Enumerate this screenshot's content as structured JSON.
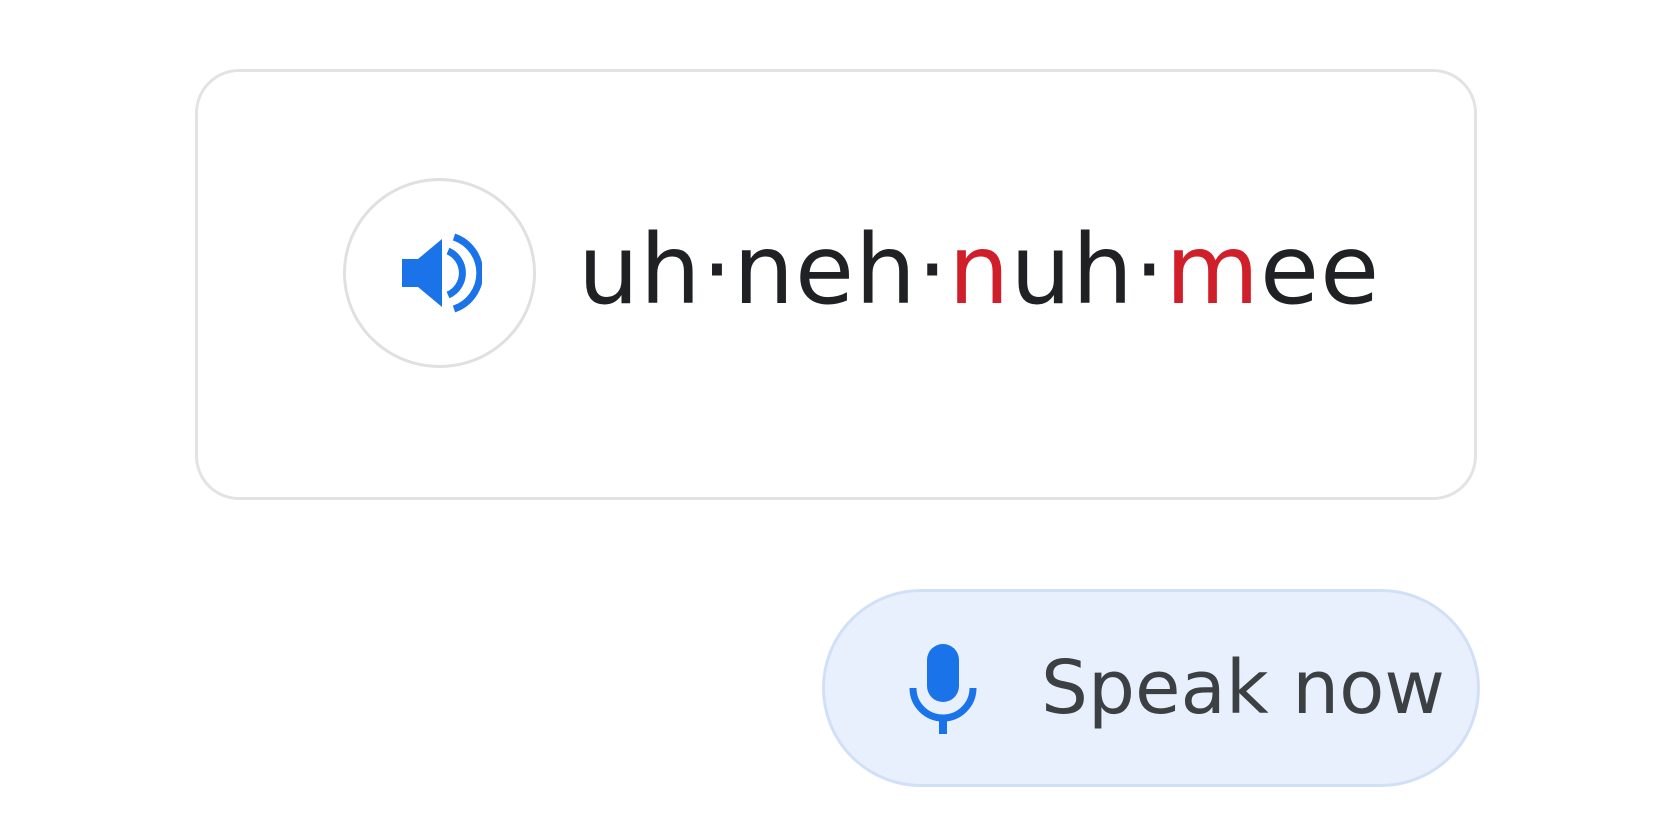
{
  "pronunciation": {
    "syllables": [
      {
        "text": "uh",
        "stressed": false
      },
      {
        "text": "·",
        "stressed": false
      },
      {
        "text": "neh",
        "stressed": false
      },
      {
        "text": "·",
        "stressed": false
      },
      {
        "text": "n",
        "stressed": true
      },
      {
        "text": "uh",
        "stressed": false
      },
      {
        "text": "·",
        "stressed": false
      },
      {
        "text": "m",
        "stressed": true
      },
      {
        "text": "ee",
        "stressed": false
      }
    ],
    "play_icon": "speaker-icon"
  },
  "speak": {
    "label": "Speak now",
    "icon": "microphone-icon"
  },
  "colors": {
    "accent": "#1a73e8",
    "stress": "#d01f2a",
    "text": "#202124",
    "speak_bg": "#e8f0fe"
  }
}
